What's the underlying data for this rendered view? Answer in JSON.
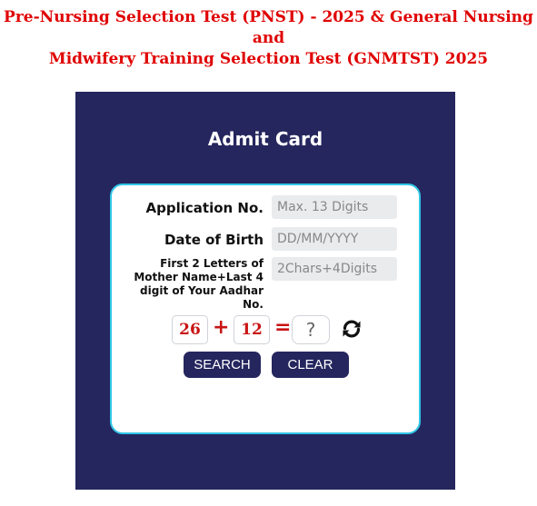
{
  "header": {
    "title_line1": "Pre-Nursing Selection Test (PNST) - 2025 & General Nursing and",
    "title_line2": "Midwifery Training Selection Test (GNMTST) 2025"
  },
  "admit_card": {
    "title": "Admit Card",
    "application_no": {
      "label": "Application No.",
      "placeholder": "Max. 13 Digits",
      "value": ""
    },
    "dob": {
      "label": "Date of Birth",
      "placeholder": "DD/MM/YYYY",
      "value": ""
    },
    "mother_aadhar": {
      "label": "First 2 Letters of Mother Name+Last 4 digit of Your Aadhar No.",
      "placeholder": "2Chars+4Digits",
      "value": ""
    },
    "captcha": {
      "operand1": "26",
      "operator": "+",
      "operand2": "12",
      "equals": "=",
      "answer_placeholder": "?"
    },
    "buttons": {
      "search": "SEARCH",
      "clear": "CLEAR"
    }
  },
  "icons": {
    "refresh": "refresh-icon"
  },
  "colors": {
    "title_red": "#e00000",
    "panel_navy": "#25265e",
    "card_border": "#31c6e6",
    "captcha_red": "#c81414"
  }
}
